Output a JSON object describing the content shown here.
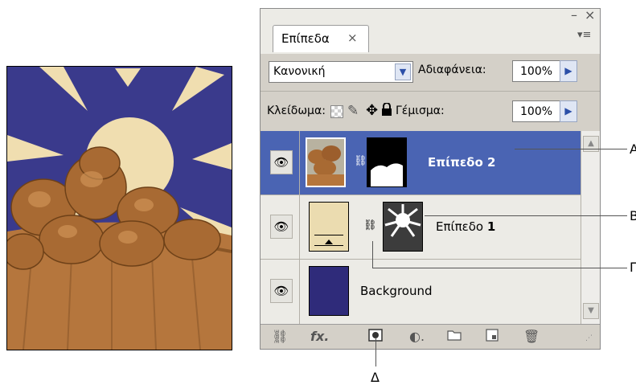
{
  "panel": {
    "tab_label": "Επίπεδα",
    "tab_close": "×",
    "window_min": "–",
    "window_close": "×",
    "menu_icon": "▾≡",
    "blend_mode": "Κανονική",
    "opacity_label": "Αδιαφάνεια:",
    "opacity_value": "100%",
    "lock_label": "Κλείδωμα:",
    "fill_label": "Γέμισμα:",
    "fill_value": "100%"
  },
  "layers": [
    {
      "name": "Επίπεδο 2",
      "selected": true,
      "has_mask": true,
      "linked": true
    },
    {
      "name_prefix": "Επίπεδο ",
      "name_number": "1",
      "selected": false,
      "has_mask": true,
      "linked": true
    },
    {
      "name": "Background",
      "selected": false,
      "has_mask": false,
      "linked": false
    }
  ],
  "toolbar_icons": [
    "link-layers-icon",
    "fx-icon",
    "add-mask-icon",
    "adjustment-layer-icon",
    "group-folder-icon",
    "new-layer-icon",
    "trash-icon"
  ],
  "callouts": {
    "a": "Α",
    "b": "Β",
    "c": "Γ",
    "d": "Δ"
  },
  "colors": {
    "selection": "#4a64b3",
    "layer1_fill": "#ebdcb0",
    "background_fill": "#2f2b7a"
  }
}
